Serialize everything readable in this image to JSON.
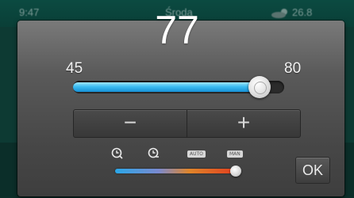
{
  "status_bar": {
    "time": "9:47",
    "day": "Środa",
    "temperature": "26.8",
    "weather_icon": "partly-cloudy-icon"
  },
  "dialog": {
    "setpoint": "77",
    "min_label": "45",
    "max_label": "80",
    "slider": {
      "min": 45,
      "max": 80,
      "value": 77
    },
    "minus_label": "−",
    "plus_label": "+",
    "modes": {
      "icons": [
        "clock-icon",
        "clock-icon"
      ],
      "badges": [
        "AUTO",
        "MAN"
      ],
      "mode_level": 1.0,
      "gradient_colors": [
        "#2aa7e8",
        "#e23a1e"
      ]
    },
    "ok_label": "OK"
  },
  "colors": {
    "slider_fill": "#3cbcf0",
    "dialog_bg": "#474747",
    "background": "#0d3a33"
  }
}
